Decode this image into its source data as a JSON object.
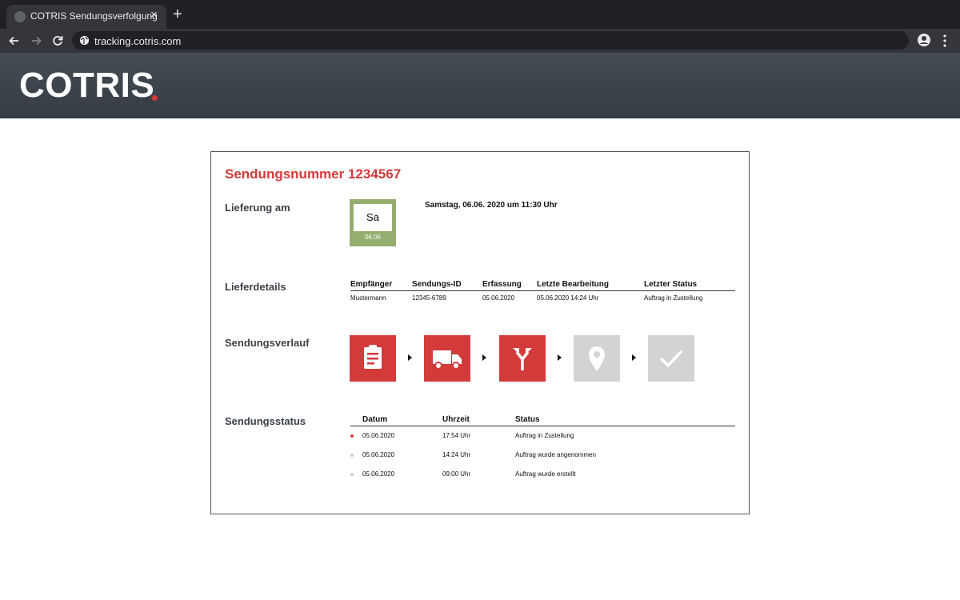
{
  "browser": {
    "tab_title": "COTRIS Sendungsverfolgung",
    "tab_close": "×",
    "new_tab": "+",
    "url": "tracking.cotris.com"
  },
  "header": {
    "logo": "COTRIS",
    "brand_color": "#d33a3a"
  },
  "card": {
    "title": "Sendungsnummer 1234567",
    "delivery": {
      "label": "Lieferung am",
      "calendar_day": "Sa",
      "calendar_date": "06.06",
      "text": "Samstag, 06.06. 2020 um 11:30 Uhr"
    },
    "details": {
      "label": "Lieferdetails",
      "headers": [
        "Empfänger",
        "Sendungs-ID",
        "Erfassung",
        "Letzte Bearbeitung",
        "Letzter Status"
      ],
      "row": [
        "Mustermann",
        "12345-6789",
        "05.06.2020",
        "05.06.2020 14:24 Uhr",
        "Auftrag in Zustellung"
      ]
    },
    "history": {
      "label": "Sendungsverlauf",
      "steps": [
        {
          "icon": "clipboard-icon",
          "active": true
        },
        {
          "icon": "truck-icon",
          "active": true
        },
        {
          "icon": "route-split-icon",
          "active": true
        },
        {
          "icon": "location-pin-icon",
          "active": false
        },
        {
          "icon": "checkmark-icon",
          "active": false
        }
      ],
      "active_color": "#d33a3a",
      "inactive_color": "#d3d3d3"
    },
    "status": {
      "label": "Sendungsstatus",
      "headers": [
        "Datum",
        "Uhrzeit",
        "Status"
      ],
      "rows": [
        {
          "date": "05.06.2020",
          "time": "17:54 Uhr",
          "status": "Auftrag in Zustellung",
          "current": true
        },
        {
          "date": "05.06.2020",
          "time": "14:24 Uhr",
          "status": "Auftrag wurde angenommen",
          "current": false
        },
        {
          "date": "05.06.2020",
          "time": "09:00 Uhr",
          "status": "Auftrag wurde erstellt",
          "current": false
        }
      ]
    }
  }
}
